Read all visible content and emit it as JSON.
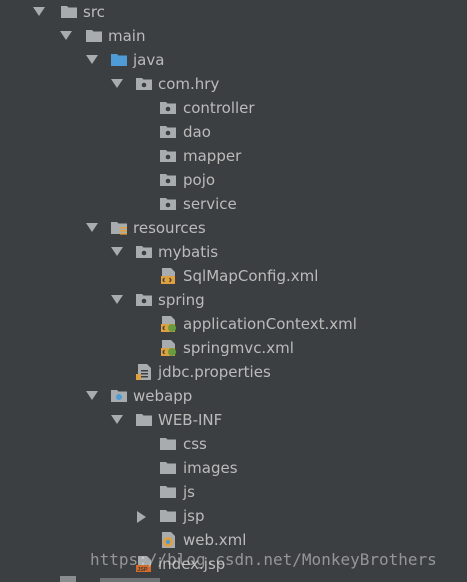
{
  "tree": {
    "nodes": [
      {
        "label": "src",
        "icon": "folder-icon"
      },
      {
        "label": "main",
        "icon": "folder-icon"
      },
      {
        "label": "java",
        "icon": "source-folder-icon"
      },
      {
        "label": "com.hry",
        "icon": "package-icon"
      },
      {
        "label": "controller",
        "icon": "package-icon"
      },
      {
        "label": "dao",
        "icon": "package-icon"
      },
      {
        "label": "mapper",
        "icon": "package-icon"
      },
      {
        "label": "pojo",
        "icon": "package-icon"
      },
      {
        "label": "service",
        "icon": "package-icon"
      },
      {
        "label": "resources",
        "icon": "resources-folder-icon"
      },
      {
        "label": "mybatis",
        "icon": "package-icon"
      },
      {
        "label": "SqlMapConfig.xml",
        "icon": "xml-file-icon"
      },
      {
        "label": "spring",
        "icon": "package-icon"
      },
      {
        "label": "applicationContext.xml",
        "icon": "spring-xml-file-icon"
      },
      {
        "label": "springmvc.xml",
        "icon": "spring-xml-file-icon"
      },
      {
        "label": "jdbc.properties",
        "icon": "properties-file-icon"
      },
      {
        "label": "webapp",
        "icon": "web-folder-icon"
      },
      {
        "label": "WEB-INF",
        "icon": "folder-icon"
      },
      {
        "label": "css",
        "icon": "folder-icon"
      },
      {
        "label": "images",
        "icon": "folder-icon"
      },
      {
        "label": "js",
        "icon": "folder-icon"
      },
      {
        "label": "jsp",
        "icon": "folder-icon"
      },
      {
        "label": "web.xml",
        "icon": "web-xml-file-icon"
      },
      {
        "label": "index.jsp",
        "icon": "jsp-file-icon"
      }
    ]
  },
  "watermark": "https://blog.csdn.net/MonkeyBrothers",
  "colors": {
    "background": "#3c3f41",
    "text": "#bbbbbb",
    "folder": "#a9acae",
    "source_folder": "#4e9bd6",
    "xml_accent": "#e0a03d"
  }
}
